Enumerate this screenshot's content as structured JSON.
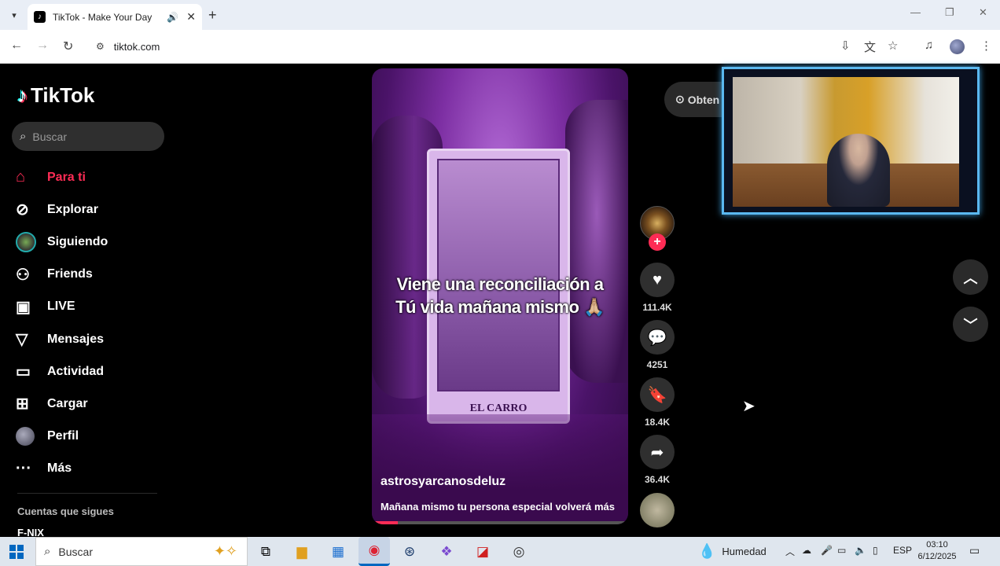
{
  "browser": {
    "tab_title": "TikTok - Make Your Day",
    "url": "tiktok.com",
    "icons": [
      "tab-dropdown-icon",
      "speaker-icon",
      "close-tab-icon",
      "new-tab-icon",
      "back-icon",
      "forward-icon",
      "reload-icon",
      "site-info-icon",
      "install-icon",
      "translate-icon",
      "bookmark-star-icon",
      "media-controls-icon",
      "menu-dots-icon"
    ]
  },
  "tiktok": {
    "logo": "TikTok",
    "search_placeholder": "Buscar",
    "nav": [
      {
        "label": "Para ti",
        "icon": "home-icon"
      },
      {
        "label": "Explorar",
        "icon": "compass-icon"
      },
      {
        "label": "Siguiendo",
        "icon": "following-avatar"
      },
      {
        "label": "Friends",
        "icon": "friends-icon"
      },
      {
        "label": "LIVE",
        "icon": "live-tv-icon"
      },
      {
        "label": "Mensajes",
        "icon": "send-icon"
      },
      {
        "label": "Actividad",
        "icon": "activity-icon"
      },
      {
        "label": "Cargar",
        "icon": "upload-plus-icon"
      },
      {
        "label": "Perfil",
        "icon": "profile-avatar"
      },
      {
        "label": "Más",
        "icon": "more-dots-icon"
      }
    ],
    "following_header": "Cuentas que sigues",
    "following_first": "F-NIX",
    "get_app": "Obten",
    "video": {
      "caption_line1": "Viene una reconciliación a",
      "caption_line2": "Tú vida mañana mismo 🙏🏼",
      "card_label": "EL CARRO",
      "author": "astrosyarcanosdeluz",
      "description": "Mañana mismo tu persona especial volverá",
      "more": "más",
      "progress": 0.1
    },
    "actions": {
      "likes": "111.4K",
      "comments": "4251",
      "saves": "18.4K",
      "shares": "36.4K"
    }
  },
  "taskbar": {
    "search_placeholder": "Buscar",
    "weather": "Humedad",
    "lang": "ESP",
    "time": "03:10",
    "date": "6/12/2025"
  },
  "colors": {
    "accent": "#fe2c55",
    "background": "#000000",
    "webcam_border": "#5ab8f0"
  }
}
